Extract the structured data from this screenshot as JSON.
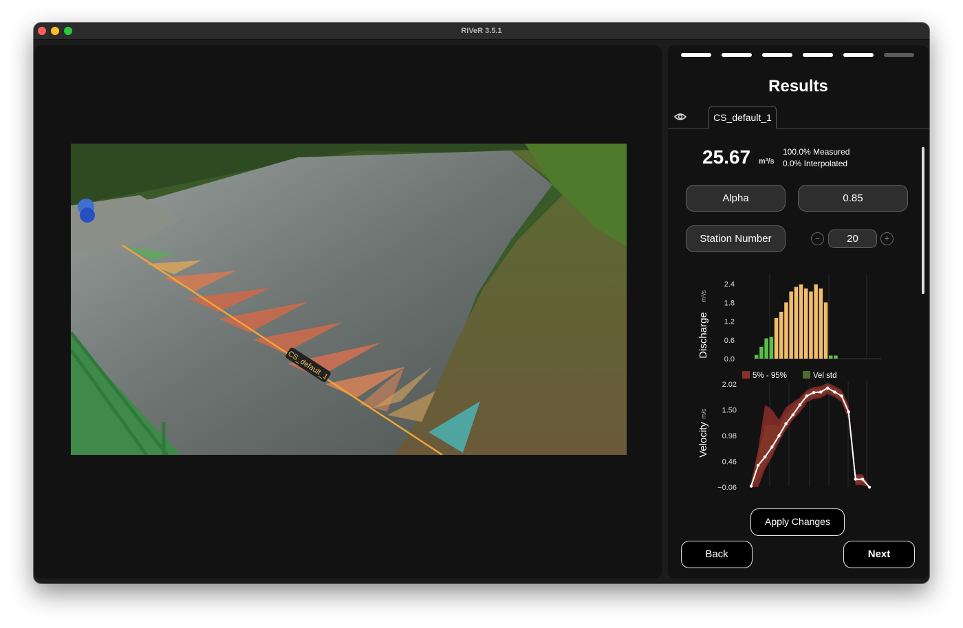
{
  "window": {
    "title": "RIVeR 3.5.1"
  },
  "image_view": {
    "section_label": "CS_default_1"
  },
  "steps": {
    "total": 6,
    "current": 5
  },
  "results": {
    "title": "Results",
    "tab": "CS_default_1",
    "discharge_value": "25.67",
    "discharge_unit": "m³/s",
    "measured": "100.0% Measured",
    "interpolated": "0.0% Interpolated",
    "alpha_label": "Alpha",
    "alpha_value": "0.85",
    "station_label": "Station Number",
    "station_value": "20",
    "decrement": "−",
    "increment": "+"
  },
  "buttons": {
    "apply": "Apply Changes",
    "back": "Back",
    "next": "Next"
  },
  "colors": {
    "accent_bar": "#f2bd6a",
    "green_bar": "#5bbf4c",
    "band_5_95": "#8b2d29",
    "band_std": "#4d6b2a"
  },
  "chart_data": [
    {
      "type": "bar",
      "ylabel": "Discharge",
      "yunit": "m³/s",
      "y_ticks": [
        "2.4",
        "1.8",
        "1.2",
        "0.6",
        "0.0"
      ],
      "ylim": [
        0,
        2.4
      ],
      "x": [
        1,
        2,
        3,
        4,
        5,
        6,
        7,
        8,
        9,
        10,
        11,
        12,
        13,
        14,
        15,
        16,
        17,
        18,
        19,
        20
      ],
      "values": [
        0.12,
        0.38,
        0.65,
        0.7,
        1.3,
        1.5,
        1.8,
        2.15,
        2.3,
        2.38,
        2.25,
        2.15,
        2.38,
        2.25,
        1.8,
        0.1,
        0.1,
        0,
        0,
        0
      ],
      "bar_colors": [
        "green",
        "green",
        "green",
        "green",
        "orange",
        "orange",
        "orange",
        "orange",
        "orange",
        "orange",
        "orange",
        "orange",
        "orange",
        "orange",
        "orange",
        "green",
        "green",
        "green",
        "green",
        "green"
      ]
    },
    {
      "type": "line",
      "ylabel": "Velocity",
      "yunit": "m/s",
      "y_ticks": [
        "2.02",
        "1.50",
        "0.98",
        "0.46",
        "−0.06"
      ],
      "ylim": [
        -0.06,
        2.02
      ],
      "legend": [
        "5% - 95%",
        "Vel std"
      ],
      "series": [
        {
          "name": "Velocity",
          "values": [
            -0.04,
            0.38,
            0.55,
            0.75,
            0.98,
            1.22,
            1.4,
            1.6,
            1.78,
            1.85,
            1.86,
            1.94,
            1.86,
            1.78,
            1.46,
            0.1,
            0.1,
            -0.06
          ]
        }
      ],
      "band_5_95": {
        "lower": [
          -0.06,
          -0.06,
          0.3,
          0.55,
          0.85,
          1.1,
          1.3,
          1.45,
          1.65,
          1.72,
          1.74,
          1.82,
          1.76,
          1.66,
          1.3,
          -0.02,
          -0.02,
          -0.06
        ],
        "upper": [
          0.05,
          0.7,
          1.6,
          1.5,
          1.3,
          1.55,
          1.65,
          1.75,
          1.9,
          1.96,
          1.98,
          2.04,
          1.98,
          1.9,
          1.6,
          0.2,
          0.2,
          -0.04
        ]
      }
    }
  ]
}
